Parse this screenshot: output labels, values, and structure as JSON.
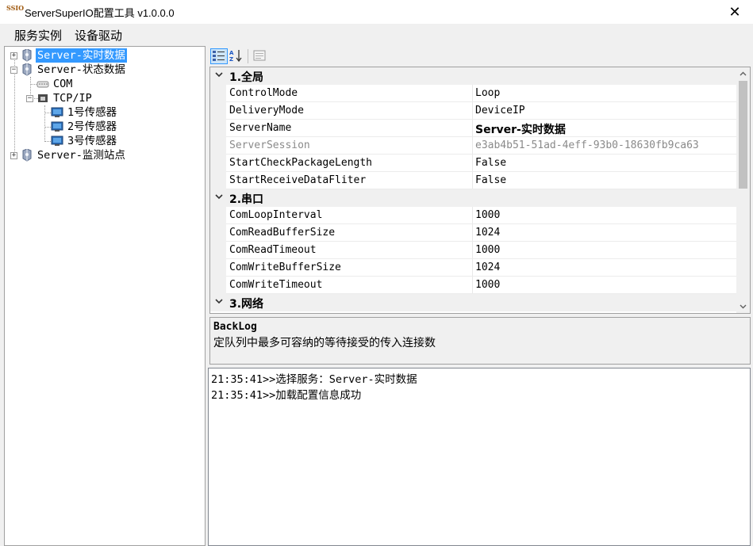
{
  "window": {
    "title": "ServerSuperIO配置工具 v1.0.0.0",
    "icon_text": "SSIO",
    "close_glyph": "✕"
  },
  "menu": {
    "items": [
      "服务实例",
      "设备驱动"
    ]
  },
  "tree": {
    "nodes": [
      {
        "label": "Server-实时数据",
        "selected": true
      },
      {
        "label": "Server-状态数据"
      },
      {
        "label": "COM"
      },
      {
        "label": "TCP/IP"
      },
      {
        "label": "1号传感器"
      },
      {
        "label": "2号传感器"
      },
      {
        "label": "3号传感器"
      },
      {
        "label": "Server-监测站点"
      }
    ],
    "expand_collapsed": "+",
    "expand_open": "−"
  },
  "property_grid": {
    "categories": [
      {
        "label": "1.全局"
      },
      {
        "label": "2.串口"
      },
      {
        "label": "3.网络"
      }
    ],
    "rows": [
      {
        "name": "ControlMode",
        "value": "Loop"
      },
      {
        "name": "DeliveryMode",
        "value": "DeviceIP"
      },
      {
        "name": "ServerName",
        "value": "Server-实时数据"
      },
      {
        "name": "ServerSession",
        "value": "e3ab4b51-51ad-4eff-93b0-18630fb9ca63"
      },
      {
        "name": "StartCheckPackageLength",
        "value": "False"
      },
      {
        "name": "StartReceiveDataFliter",
        "value": "False"
      },
      {
        "name": "ComLoopInterval",
        "value": "1000"
      },
      {
        "name": "ComReadBufferSize",
        "value": "1024"
      },
      {
        "name": "ComReadTimeout",
        "value": "1000"
      },
      {
        "name": "ComWriteBufferSize",
        "value": "1024"
      },
      {
        "name": "ComWriteTimeout",
        "value": "1000"
      }
    ],
    "help": {
      "title": "BackLog",
      "description": "定队列中最多可容纳的等待接受的传入连接数"
    }
  },
  "log": {
    "lines": [
      "21:35:41>>选择服务：Server-实时数据",
      "21:35:41>>加载配置信息成功"
    ]
  },
  "colors": {
    "selection": "#3399ff",
    "panel_bg": "#f0f0f0",
    "readonly_text": "#8a8a8a"
  }
}
